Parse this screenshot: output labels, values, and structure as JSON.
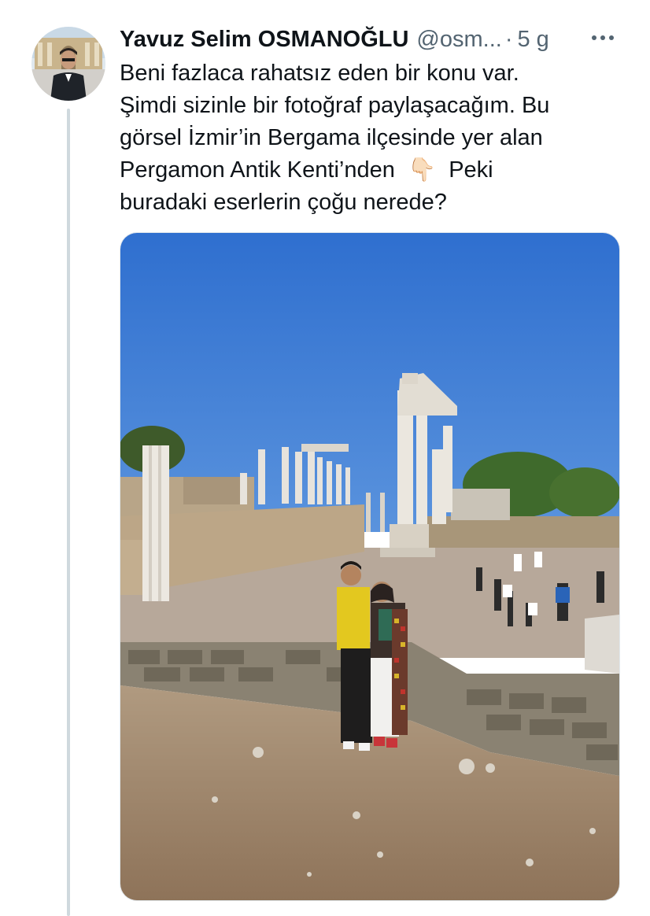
{
  "tweet": {
    "display_name": "Yavuz Selim OSMANOĞLU",
    "handle": "@osm...",
    "separator": "·",
    "time": "5 g",
    "text_lines": [
      "Beni fazlaca rahatsız eden bir konu var.",
      "Şimdi sizinle bir fotoğraf paylaşacağım. Bu",
      "görsel İzmir’in Bergama ilçesinde yer alan",
      "Pergamon Antik Kenti’nden",
      "Peki",
      "buradaki eserlerin çoğu nerede?"
    ],
    "emoji": "👇🏻"
  },
  "icons": {
    "more": "more-horizontal-icon",
    "avatar": "user-avatar"
  },
  "colors": {
    "text_primary": "#0f1419",
    "text_secondary": "#536471",
    "thread_line": "#cfd9de",
    "sky": "#3f7fd6",
    "ground": "#a38a6e"
  }
}
